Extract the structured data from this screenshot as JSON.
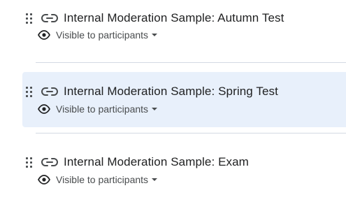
{
  "items": [
    {
      "title": "Internal Moderation Sample: Autumn Test",
      "visibility": "Visible to participants",
      "highlighted": false
    },
    {
      "title": "Internal Moderation Sample: Spring Test",
      "visibility": "Visible to participants",
      "highlighted": true
    },
    {
      "title": "Internal Moderation Sample: Exam",
      "visibility": "Visible to participants",
      "highlighted": false
    }
  ],
  "icons": {
    "drag": "drag-handle-icon",
    "link": "link-icon",
    "visibility": "eye-icon",
    "dropdown": "caret-down-icon"
  },
  "colors": {
    "highlight_background": "#e8f0fb",
    "divider": "#d3d9e3",
    "text": "#202122",
    "muted_text": "#494c4e"
  }
}
